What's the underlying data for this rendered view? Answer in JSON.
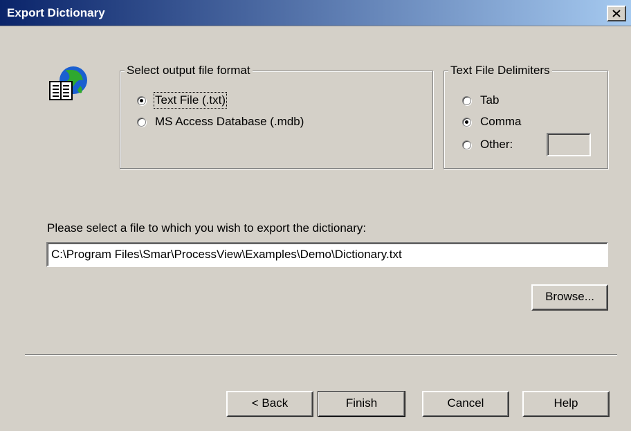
{
  "window": {
    "title": "Export Dictionary",
    "close_label": "×"
  },
  "format_group": {
    "legend": "Select output file format",
    "options": [
      {
        "label": "Text File (.txt)",
        "selected": true
      },
      {
        "label": "MS Access Database (.mdb)",
        "selected": false
      }
    ]
  },
  "delimiter_group": {
    "legend": "Text File Delimiters",
    "options": [
      {
        "label": "Tab",
        "selected": false
      },
      {
        "label": "Comma",
        "selected": true
      },
      {
        "label": "Other:",
        "selected": false
      }
    ],
    "other_value": ""
  },
  "file": {
    "prompt": "Please select a file to which you wish to export the dictionary:",
    "path": "C:\\Program Files\\Smar\\ProcessView\\Examples\\Demo\\Dictionary.txt",
    "browse_label": "Browse..."
  },
  "buttons": {
    "back": "< Back",
    "finish": "Finish",
    "cancel": "Cancel",
    "help": "Help"
  },
  "icons": {
    "app_icon": "globe-book-icon",
    "close_icon": "close-icon"
  }
}
